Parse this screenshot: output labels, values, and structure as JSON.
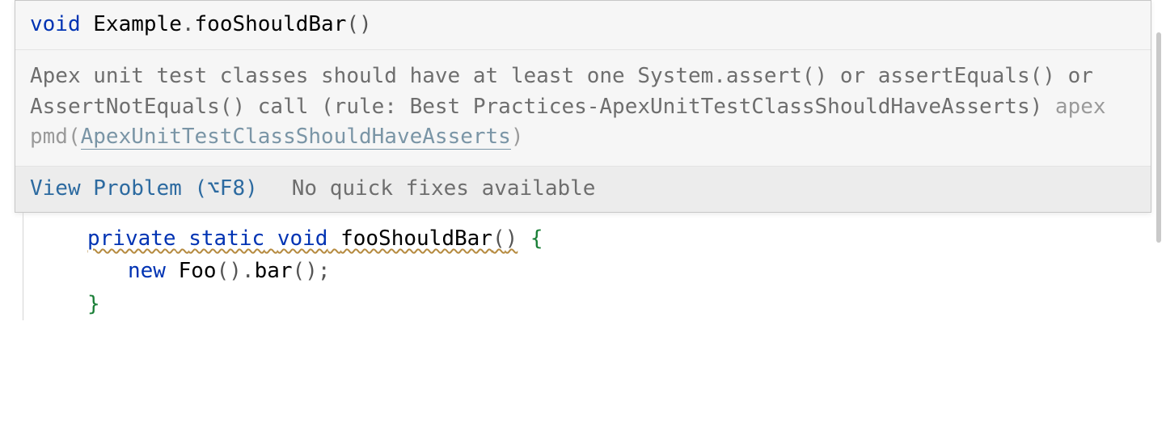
{
  "tooltip": {
    "signature": {
      "keyword": "void",
      "class": "Example",
      "dot": ".",
      "method": "fooShouldBar",
      "paren_open": "(",
      "paren_close": ")"
    },
    "message": "Apex unit test classes should have at least one System.assert() or assertEquals() or AssertNotEquals() call (rule: Best Practices-ApexUnitTestClassShouldHaveAsserts)",
    "tool_prefix": " apex pmd(",
    "rule_link": "ApexUnitTestClassShouldHaveAsserts",
    "tool_suffix": ")",
    "footer": {
      "view_problem": "View Problem (⌥F8)",
      "no_fixes": "No quick fixes available"
    }
  },
  "code": {
    "line1": {
      "kw_private": "private",
      "sp1": " ",
      "kw_static": "static",
      "sp2": " ",
      "kw_void": "void",
      "sp3": " ",
      "method": "fooShouldBar",
      "paren_open": "(",
      "paren_close": ")",
      "sp4": " ",
      "brace_open": "{"
    },
    "line2": {
      "kw_new": "new",
      "sp": " ",
      "type": "Foo",
      "paren_open": "(",
      "paren_close": ")",
      "dot": ".",
      "call": "bar",
      "call_open": "(",
      "call_close": ")",
      "semi": ";"
    },
    "line3": {
      "brace_close": "}"
    }
  }
}
